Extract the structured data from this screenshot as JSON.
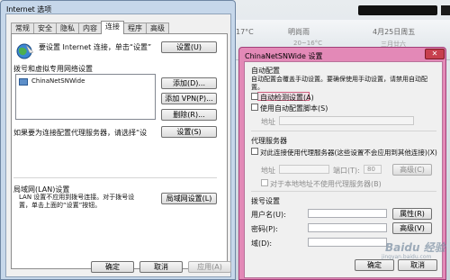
{
  "desktop": {
    "weather": {
      "temp": "17°C",
      "location": "明尚雨",
      "range": "20~16°C",
      "date": "4月25日周五",
      "lunar": "三月廿六"
    }
  },
  "internet_options": {
    "title": "Internet 选项",
    "tabs": [
      "常规",
      "安全",
      "隐私",
      "内容",
      "连接",
      "程序",
      "高级"
    ],
    "active_tab": "连接",
    "setup_text": "要设置 Internet 连接，单击“设置”",
    "setup_button": "设置(U)",
    "dialup_section": "拨号和虚拟专用网络设置",
    "connection_item": "ChinaNetSNWide",
    "add_button": "添加(D)...",
    "add_vpn_button": "添加 VPN(P)...",
    "remove_button": "删除(R)...",
    "settings_button": "设置(S)",
    "proxy_hint": "如果要为连接配置代理服务器，请选择“设",
    "lan_section": "局域网(LAN)设置",
    "lan_text_1": "LAN 设置不应用到拨号连接。对于拨号设",
    "lan_text_2": "置，单击上面的“设置”按钮。",
    "lan_button": "局域网设置(L)",
    "ok_button": "确定",
    "cancel_button": "取消",
    "apply_button": "应用(A)"
  },
  "conn_settings": {
    "title": "ChinaNetSNWide 设置",
    "close_glyph": "✕",
    "auto_config": "自动配置",
    "auto_desc_1": "自动配置会覆盖手动设置。要确保使用手动设置，请禁用自动配",
    "auto_desc_2": "置。",
    "auto_detect": "自动检测设置(A)",
    "auto_script": "使用自动配置脚本(S)",
    "address_label": "地址",
    "proxy_section": "代理服务器",
    "use_proxy": "对此连接使用代理服务器(这些设置不会应用到其他连接)(X)",
    "proxy_address_label": "地址",
    "port_label": "端口(T):",
    "port_value": "80",
    "advanced_button": "高级(C)",
    "bypass_local": "对于本地地址不使用代理服务器(B)",
    "dialup_section": "拨号设置",
    "username_label": "用户名(U):",
    "password_label": "密码(P):",
    "domain_label": "域(D):",
    "properties_button": "属性(R)",
    "advanced2_button": "高级(V)",
    "ok_button": "确定",
    "cancel_button": "取消"
  },
  "watermark": {
    "logo_text": "Baidu 经验",
    "url_text": "jingyan.baidu.com"
  }
}
